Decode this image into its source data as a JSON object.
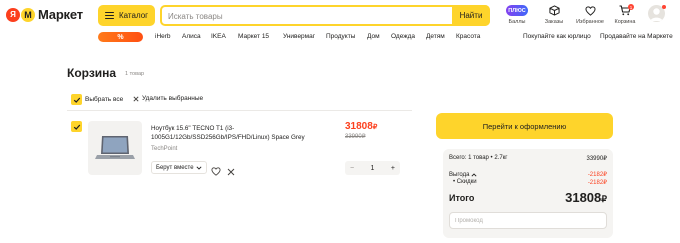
{
  "header": {
    "logo_ya": "Я",
    "logo_m": "М",
    "logo_text": "Маркет",
    "catalog_label": "Каталог",
    "search_placeholder": "Искать товары",
    "search_button": "Найти",
    "plus_badge": "ПЛЮС",
    "icons": [
      {
        "name": "plus-icon",
        "label": "Баллы"
      },
      {
        "name": "orders-icon",
        "label": "Заказы"
      },
      {
        "name": "favorites-icon",
        "label": "Избранное"
      },
      {
        "name": "cart-icon",
        "label": "Корзина",
        "badge": "1"
      }
    ]
  },
  "nav": {
    "promo_label": "%",
    "items": [
      "iHerb",
      "Алиса",
      "IKEA",
      "Маркет 15",
      "Универмаг",
      "Продукты",
      "Дом",
      "Одежда",
      "Детям",
      "Красота"
    ],
    "right_items": [
      "Покупайте как юрлицо",
      "Продавайте на Маркете"
    ]
  },
  "cart": {
    "title": "Корзина",
    "count": "1 товар",
    "select_all": "Выбрать все",
    "delete_selected": "Удалить выбранные",
    "item": {
      "name": "Ноутбук 15.6\" TECNO T1 (i3-1005G1/12Gb/SSD256Gb/IPS/FHD/Linux) Space Grey",
      "seller": "TechPoint",
      "buy_together": "Берут вместе",
      "price_new": "31808",
      "price_old": "33990",
      "currency": "₽",
      "quantity": "1",
      "minus": "−",
      "plus": "+"
    }
  },
  "summary": {
    "checkout_button": "Перейти к оформлению",
    "total_items_label": "Всего: 1 товар • 2.7кг",
    "total_items_value": "33990",
    "benefit_label": "Выгода",
    "benefit_value": "-2182",
    "discount_label": "• Скидки",
    "discount_value": "-2182",
    "total_label": "Итого",
    "total_value": "31808",
    "currency": "₽",
    "promo_placeholder": "Промокод"
  },
  "colors": {
    "yellow": "#fed42b",
    "red": "#fc3f1d",
    "grey_bg": "#f5f4f2"
  }
}
